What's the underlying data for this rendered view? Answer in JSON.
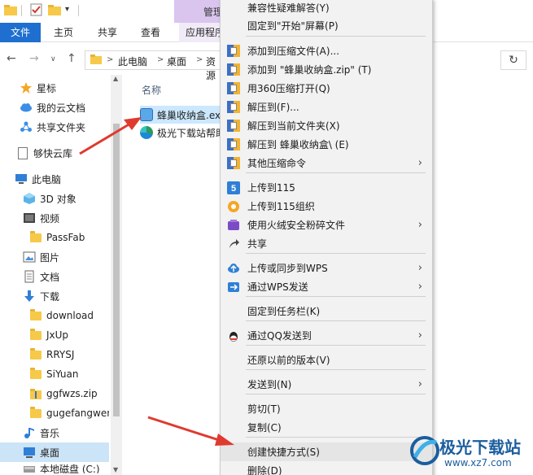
{
  "titlebar": {
    "manage_tab": "管理"
  },
  "ribbon": {
    "tabs": {
      "file": "文件",
      "home": "主页",
      "share": "共享",
      "view": "查看",
      "app": "应用程序"
    }
  },
  "address": {
    "crumbs": [
      "此电脑",
      "桌面",
      "资源"
    ],
    "separator": ">",
    "back": "←",
    "forward": "→",
    "dropdown": "∨",
    "up": "↑",
    "refresh": "↻"
  },
  "sidebar": {
    "items": [
      {
        "label": "星标",
        "icon": "star-icon"
      },
      {
        "label": "我的云文档",
        "icon": "cloud-icon"
      },
      {
        "label": "共享文件夹",
        "icon": "share-folder-icon"
      },
      {
        "label": "够快云库",
        "icon": "document-icon"
      },
      {
        "label": "此电脑",
        "icon": "computer-icon"
      },
      {
        "label": "3D 对象",
        "icon": "3d-objects-icon"
      },
      {
        "label": "视频",
        "icon": "video-icon"
      },
      {
        "label": "PassFab",
        "icon": "folder-icon"
      },
      {
        "label": "图片",
        "icon": "pictures-icon"
      },
      {
        "label": "文档",
        "icon": "documents-icon"
      },
      {
        "label": "下载",
        "icon": "download-icon"
      },
      {
        "label": "download",
        "icon": "folder-icon"
      },
      {
        "label": "JxUp",
        "icon": "folder-icon"
      },
      {
        "label": "RRYSJ",
        "icon": "folder-icon"
      },
      {
        "label": "SiYuan",
        "icon": "folder-icon"
      },
      {
        "label": "ggfwzs.zip",
        "icon": "zip-folder-icon"
      },
      {
        "label": "gugefangwen",
        "icon": "folder-icon"
      },
      {
        "label": "音乐",
        "icon": "music-icon"
      },
      {
        "label": "桌面",
        "icon": "desktop-icon"
      },
      {
        "label": "本地磁盘 (C:)",
        "icon": "drive-icon"
      }
    ]
  },
  "files": {
    "column_name": "名称",
    "rows": [
      {
        "name": "蜂巢收纳盒.exe",
        "icon": "app-icon"
      },
      {
        "name": "极光下载站帮助",
        "icon": "edge-icon"
      }
    ]
  },
  "context_menu": {
    "items": [
      {
        "label": "兼容性疑难解答(Y)",
        "icon": "",
        "submenu": false
      },
      {
        "label": "固定到\"开始\"屏幕(P)",
        "icon": "",
        "submenu": false
      },
      {
        "label": "添加到压缩文件(A)...",
        "icon": "zip-icon",
        "submenu": false
      },
      {
        "label": "添加到 \"蜂巢收纳盒.zip\" (T)",
        "icon": "zip-icon",
        "submenu": false
      },
      {
        "label": "用360压缩打开(Q)",
        "icon": "zip-icon",
        "submenu": false
      },
      {
        "label": "解压到(F)...",
        "icon": "zip-icon",
        "submenu": false
      },
      {
        "label": "解压到当前文件夹(X)",
        "icon": "zip-icon",
        "submenu": false
      },
      {
        "label": "解压到 蜂巢收纳盒\\ (E)",
        "icon": "zip-icon",
        "submenu": false
      },
      {
        "label": "其他压缩命令",
        "icon": "zip-icon",
        "submenu": true
      },
      {
        "label": "上传到115",
        "icon": "115-icon",
        "submenu": false
      },
      {
        "label": "上传到115组织",
        "icon": "115-org-icon",
        "submenu": false
      },
      {
        "label": "使用火绒安全粉碎文件",
        "icon": "huorong-icon",
        "submenu": true
      },
      {
        "label": "共享",
        "icon": "share-icon",
        "submenu": false
      },
      {
        "label": "上传或同步到WPS",
        "icon": "wps-cloud-icon",
        "submenu": true
      },
      {
        "label": "通过WPS发送",
        "icon": "wps-send-icon",
        "submenu": true
      },
      {
        "label": "固定到任务栏(K)",
        "icon": "",
        "submenu": false
      },
      {
        "label": "通过QQ发送到",
        "icon": "qq-icon",
        "submenu": true
      },
      {
        "label": "还原以前的版本(V)",
        "icon": "",
        "submenu": false
      },
      {
        "label": "发送到(N)",
        "icon": "",
        "submenu": true
      },
      {
        "label": "剪切(T)",
        "icon": "",
        "submenu": false
      },
      {
        "label": "复制(C)",
        "icon": "",
        "submenu": false
      },
      {
        "label": "创建快捷方式(S)",
        "icon": "",
        "submenu": false
      },
      {
        "label": "删除(D)",
        "icon": "",
        "submenu": false
      }
    ],
    "submenu_arrow": "›"
  },
  "watermark": {
    "title": "极光下载站",
    "url": "www.xz7.com"
  },
  "colors": {
    "accent": "#1e6fcf",
    "selection": "#cce4f7",
    "arrow": "#e03a2f",
    "menu_bg": "#f2f2f2"
  }
}
